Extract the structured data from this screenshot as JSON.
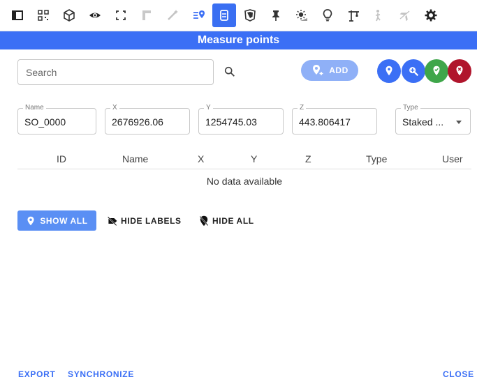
{
  "toolbar": {
    "icons": [
      "panel-icon",
      "qr-icon",
      "cube-icon",
      "eye-icon",
      "focus-icon",
      "ruler-icon",
      "magic-wand-icon",
      "measure-points-icon",
      "layers-icon",
      "shield-icon",
      "pin-icon",
      "sun-icon",
      "lightbulb-icon",
      "crane-icon",
      "person-icon",
      "plane-icon",
      "gear-icon"
    ]
  },
  "title": "Measure points",
  "search": {
    "placeholder": "Search",
    "value": ""
  },
  "add_label": "ADD",
  "action_colors": {
    "blue": "#3b6ff5",
    "green": "#3fa64a",
    "red": "#b0152c"
  },
  "fields": {
    "name": {
      "label": "Name",
      "value": "SO_0000"
    },
    "x": {
      "label": "X",
      "value": "2676926.06"
    },
    "y": {
      "label": "Y",
      "value": "1254745.03"
    },
    "z": {
      "label": "Z",
      "value": "443.806417"
    },
    "type": {
      "label": "Type",
      "value": "Staked ..."
    }
  },
  "table": {
    "headers": [
      "ID",
      "Name",
      "X",
      "Y",
      "Z",
      "Type",
      "User"
    ],
    "empty_text": "No data available"
  },
  "buttons": {
    "show_all": "SHOW ALL",
    "hide_labels": "HIDE LABELS",
    "hide_all": "HIDE ALL"
  },
  "footer": {
    "export": "EXPORT",
    "synchronize": "SYNCHRONIZE",
    "close": "CLOSE"
  }
}
